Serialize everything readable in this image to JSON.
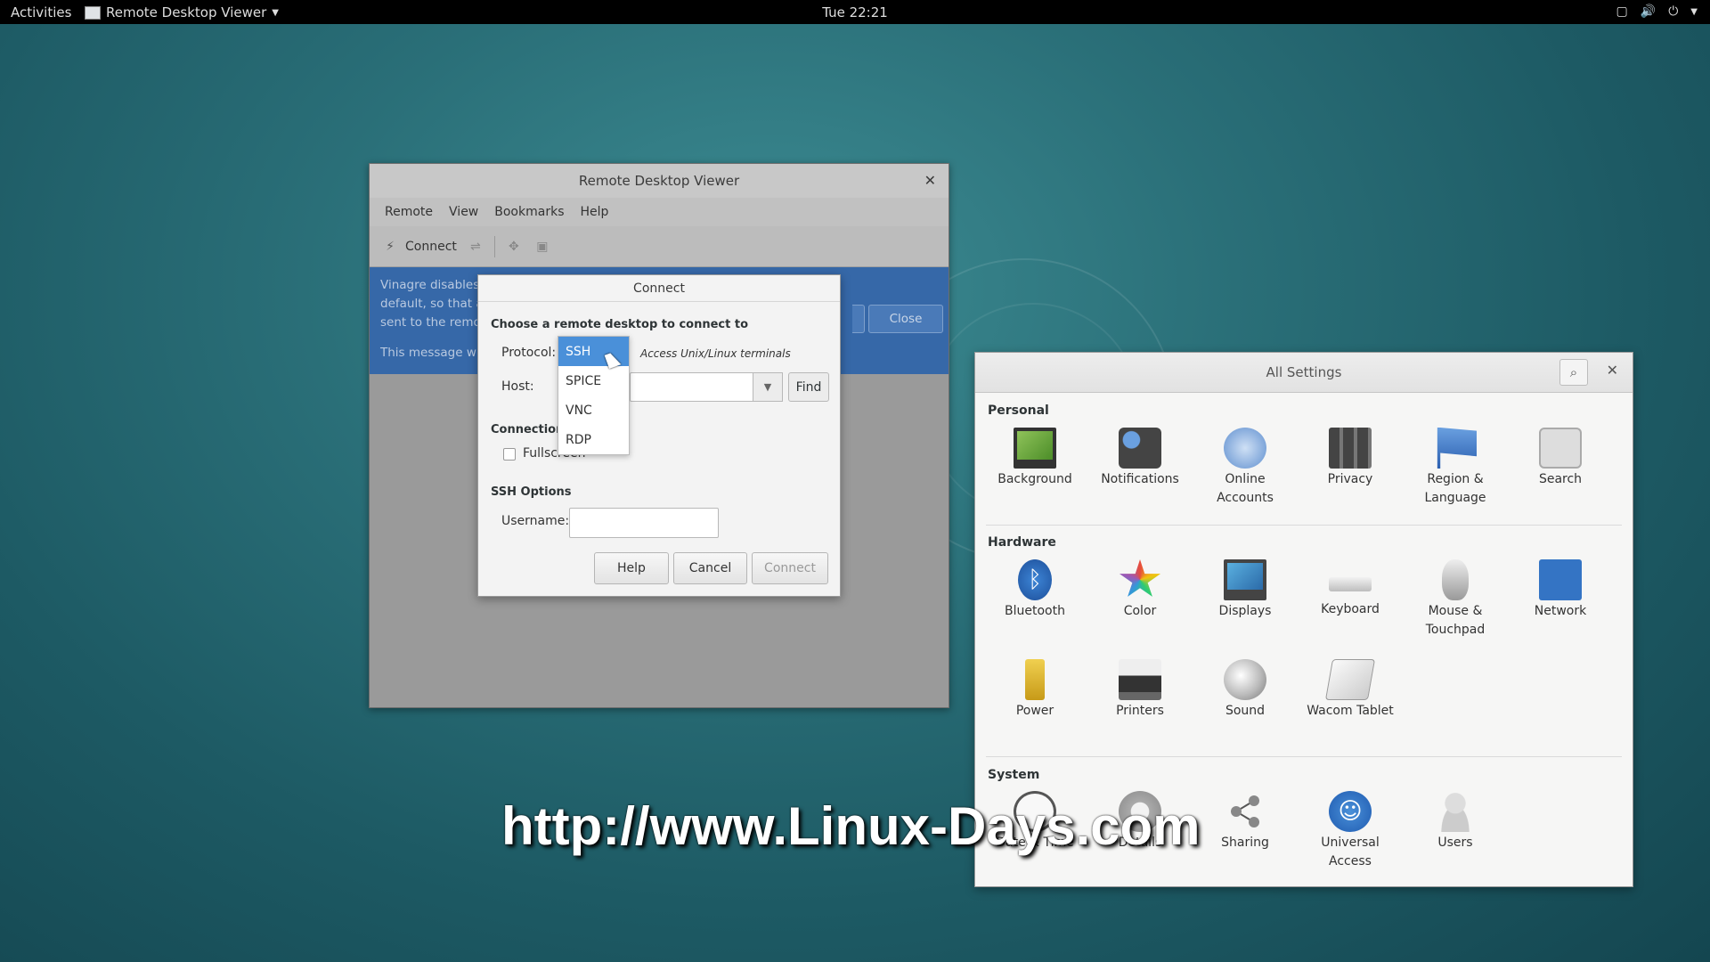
{
  "topbar": {
    "activities": "Activities",
    "app_name": "Remote Desktop Viewer",
    "clock": "Tue 22:21",
    "tray_icons": [
      "window-icon",
      "volume-icon",
      "power-icon",
      "chevron-down-icon"
    ]
  },
  "rdv": {
    "title": "Remote Desktop Viewer",
    "menu": [
      "Remote",
      "View",
      "Bookmarks",
      "Help"
    ],
    "toolbar": {
      "connect_label": "Connect"
    },
    "infobar": {
      "line1": "Vinagre disables",
      "line2": "default, so that a",
      "line3": "sent to the remo",
      "line4": "This message wil",
      "close_label": "Close"
    }
  },
  "connect_dialog": {
    "title": "Connect",
    "heading": "Choose a remote desktop to connect to",
    "protocol_label": "Protocol:",
    "protocol_desc": "Access Unix/Linux terminals",
    "host_label": "Host:",
    "find_label": "Find",
    "connection_heading": "Connection",
    "fullscreen_label": "Fullscreen",
    "ssh_heading": "SSH Options",
    "username_label": "Username:",
    "username_value": "",
    "buttons": {
      "help": "Help",
      "cancel": "Cancel",
      "connect": "Connect"
    }
  },
  "protocol_dropdown": {
    "options": [
      "SSH",
      "SPICE",
      "VNC",
      "RDP"
    ],
    "selected": "SSH"
  },
  "settings": {
    "title": "All Settings",
    "sections": {
      "personal": "Personal",
      "hardware": "Hardware",
      "system": "System"
    },
    "personal": [
      {
        "l1": "Background",
        "l2": ""
      },
      {
        "l1": "Notifications",
        "l2": ""
      },
      {
        "l1": "Online",
        "l2": "Accounts"
      },
      {
        "l1": "Privacy",
        "l2": ""
      },
      {
        "l1": "Region &",
        "l2": "Language"
      },
      {
        "l1": "Search",
        "l2": ""
      }
    ],
    "hardware": [
      {
        "l1": "Bluetooth",
        "l2": ""
      },
      {
        "l1": "Color",
        "l2": ""
      },
      {
        "l1": "Displays",
        "l2": ""
      },
      {
        "l1": "Keyboard",
        "l2": ""
      },
      {
        "l1": "Mouse &",
        "l2": "Touchpad"
      },
      {
        "l1": "Network",
        "l2": ""
      },
      {
        "l1": "Power",
        "l2": ""
      },
      {
        "l1": "Printers",
        "l2": ""
      },
      {
        "l1": "Sound",
        "l2": ""
      },
      {
        "l1": "Wacom Tablet",
        "l2": ""
      }
    ],
    "system": [
      {
        "l1": "Date & Time",
        "l2": ""
      },
      {
        "l1": "Details",
        "l2": ""
      },
      {
        "l1": "Sharing",
        "l2": ""
      },
      {
        "l1": "Universal",
        "l2": "Access"
      },
      {
        "l1": "Users",
        "l2": ""
      }
    ]
  },
  "watermark": "http://www.Linux-Days.com"
}
